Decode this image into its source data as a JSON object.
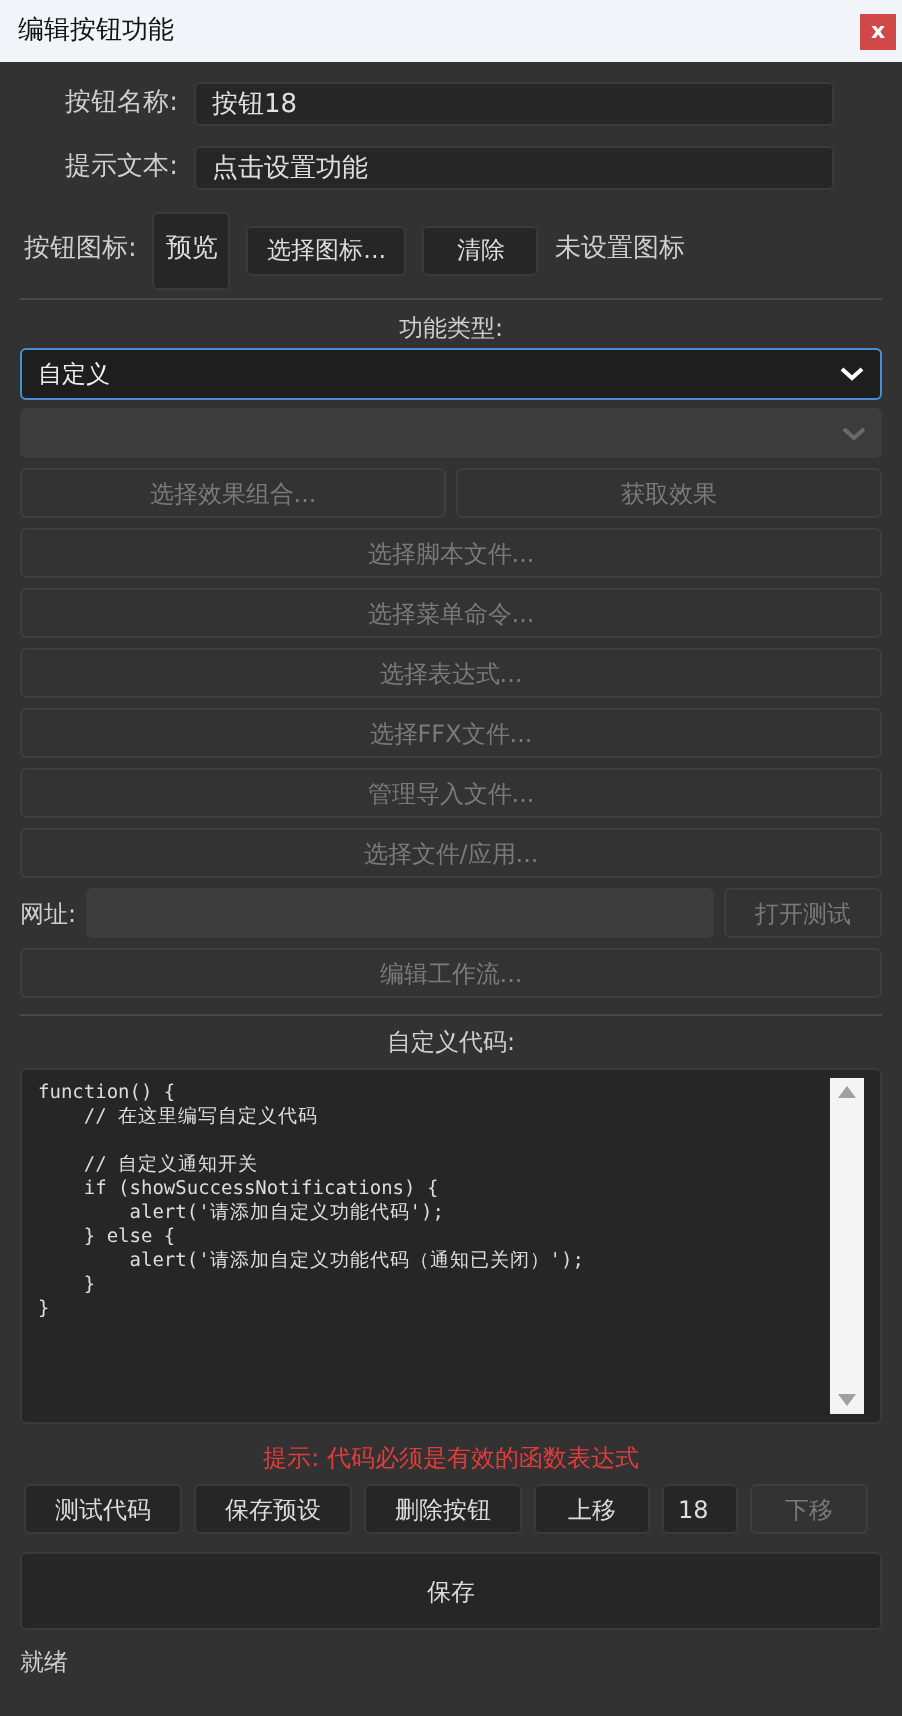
{
  "window": {
    "title": "编辑按钮功能",
    "close": "x"
  },
  "fields": [
    {
      "label": "按钮名称:",
      "value": "按钮18"
    },
    {
      "label": "提示文本:",
      "value": "点击设置功能"
    }
  ],
  "icon_row": {
    "label": "按钮图标:",
    "preview": "预览",
    "buttons": [
      {
        "label": "选择图标...",
        "disabled": false
      },
      {
        "label": "清除",
        "disabled": false
      }
    ],
    "status": "未设置图标"
  },
  "function_type": {
    "label": "功能类型:",
    "select": {
      "value": "自定义",
      "disabled": false
    },
    "sub_select": {
      "disabled": true
    }
  },
  "action_rows": [
    {
      "kind": "buttons",
      "buttons": [
        {
          "label": "选择效果组合...",
          "disabled": true
        },
        {
          "label": "获取效果",
          "disabled": true
        }
      ]
    },
    {
      "kind": "buttons",
      "buttons": [
        {
          "label": "选择脚本文件...",
          "disabled": true
        }
      ]
    },
    {
      "kind": "buttons",
      "buttons": [
        {
          "label": "选择菜单命令...",
          "disabled": true
        }
      ]
    },
    {
      "kind": "buttons",
      "buttons": [
        {
          "label": "选择表达式...",
          "disabled": true
        }
      ]
    },
    {
      "kind": "buttons",
      "buttons": [
        {
          "label": "选择FFX文件...",
          "disabled": true
        }
      ]
    },
    {
      "kind": "buttons",
      "buttons": [
        {
          "label": "管理导入文件...",
          "disabled": true
        }
      ]
    },
    {
      "kind": "buttons",
      "buttons": [
        {
          "label": "选择文件/应用...",
          "disabled": true
        }
      ]
    },
    {
      "kind": "url",
      "label": "网址:",
      "disabled": true,
      "buttons": [
        {
          "label": "打开测试",
          "disabled": true
        }
      ]
    },
    {
      "kind": "buttons",
      "buttons": [
        {
          "label": "编辑工作流...",
          "disabled": true
        }
      ]
    }
  ],
  "code_section": {
    "label": "自定义代码:",
    "code": "function() {\n    // 在这里编写自定义代码\n\n    // 自定义通知开关\n    if (showSuccessNotifications) {\n        alert('请添加自定义功能代码');\n    } else {\n        alert('请添加自定义功能代码（通知已关闭）');\n    }\n}",
    "hint": "提示: 代码必须是有效的函数表达式"
  },
  "bottom_bar": [
    {
      "kind": "button",
      "label": "测试代码",
      "disabled": false
    },
    {
      "kind": "button",
      "label": "保存预设",
      "disabled": false
    },
    {
      "kind": "button",
      "label": "删除按钮",
      "disabled": false
    },
    {
      "kind": "button",
      "label": "上移",
      "disabled": false
    },
    {
      "kind": "input",
      "value": "18"
    },
    {
      "kind": "button",
      "label": "下移",
      "disabled": true
    }
  ],
  "save_button": {
    "label": "保存"
  },
  "status_bar": {
    "text": "就绪"
  }
}
